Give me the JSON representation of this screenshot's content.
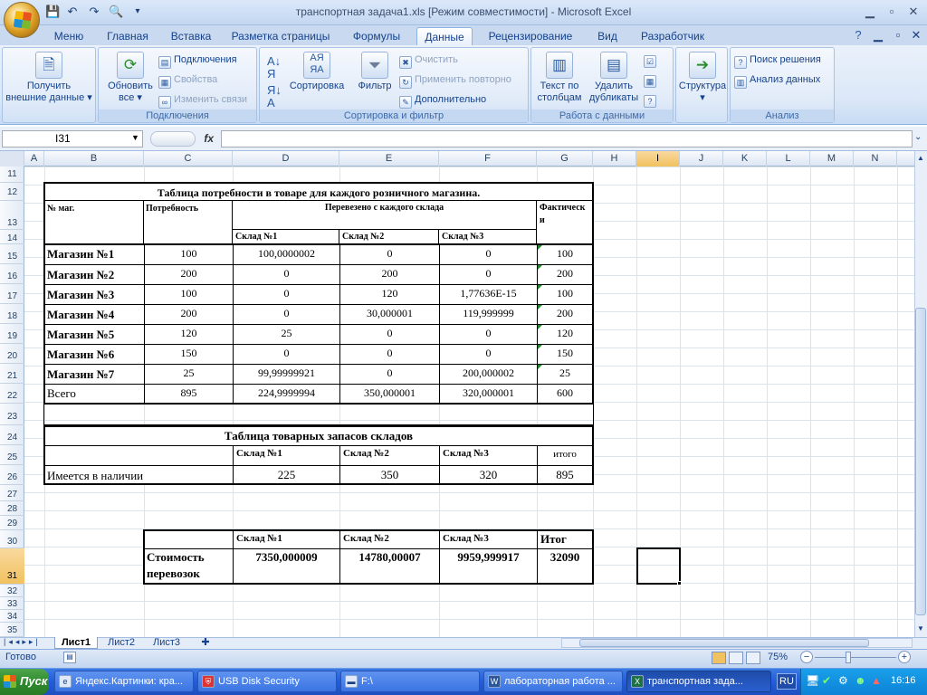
{
  "window": {
    "title": "транспортная задача1.xls  [Режим совместимости] - Microsoft Excel"
  },
  "ribbon_tabs": [
    "Меню",
    "Главная",
    "Вставка",
    "Разметка страницы",
    "Формулы",
    "Данные",
    "Рецензирование",
    "Вид",
    "Разработчик"
  ],
  "ribbon": {
    "get_external": {
      "line1": "Получить",
      "line2": "внешние данные ▾"
    },
    "refresh": {
      "line1": "Обновить",
      "line2": "все ▾"
    },
    "connections": "Подключения",
    "properties": "Свойства",
    "edit_links": "Изменить связи",
    "group_connections": "Подключения",
    "sort": "Сортировка",
    "filter": "Фильтр",
    "clear": "Очистить",
    "reapply": "Применить повторно",
    "advanced": "Дополнительно",
    "group_sort": "Сортировка и фильтр",
    "text_to_cols": {
      "line1": "Текст по",
      "line2": "столбцам"
    },
    "remove_dup": {
      "line1": "Удалить",
      "line2": "дубликаты"
    },
    "group_data": "Работа с данными",
    "outline": {
      "line1": "Структура",
      "line2": "▾"
    },
    "solver": "Поиск решения",
    "data_analysis": "Анализ данных",
    "group_analysis": "Анализ"
  },
  "name_box": "I31",
  "fx": "fx",
  "columns": [
    "A",
    "B",
    "C",
    "D",
    "E",
    "F",
    "G",
    "H",
    "I",
    "J",
    "K",
    "L",
    "M",
    "N"
  ],
  "rows": [
    "11",
    "12",
    "13",
    "14",
    "15",
    "16",
    "17",
    "18",
    "19",
    "20",
    "21",
    "22",
    "23",
    "24",
    "25",
    "26",
    "27",
    "28",
    "29",
    "30",
    "31",
    "32",
    "33",
    "34",
    "35"
  ],
  "table1": {
    "title": "Таблица потребности в товаре для каждого розничного магазина.",
    "h_shop": "№ маг.",
    "h_need": "Потребность",
    "h_shipped": "Перевезено с каждого склада",
    "h_actual": "Фактически",
    "h_w1": "Склад №1",
    "h_w2": "Склад №2",
    "h_w3": "Склад №3",
    "rows": [
      {
        "shop": "Магазин №1",
        "need": "100",
        "w1": "100,0000002",
        "w2": "0",
        "w3": "0",
        "actual": "100"
      },
      {
        "shop": "Магазин №2",
        "need": "200",
        "w1": "0",
        "w2": "200",
        "w3": "0",
        "actual": "200"
      },
      {
        "shop": "Магазин №3",
        "need": "100",
        "w1": "0",
        "w2": "120",
        "w3": "1,77636E-15",
        "actual": "100"
      },
      {
        "shop": "Магазин №4",
        "need": "200",
        "w1": "0",
        "w2": "30,000001",
        "w3": "119,999999",
        "actual": "200"
      },
      {
        "shop": "Магазин №5",
        "need": "120",
        "w1": "25",
        "w2": "0",
        "w3": "0",
        "actual": "120"
      },
      {
        "shop": "Магазин №6",
        "need": "150",
        "w1": "0",
        "w2": "0",
        "w3": "0",
        "actual": "150"
      },
      {
        "shop": "Магазин №7",
        "need": "25",
        "w1": "99,99999921",
        "w2": "0",
        "w3": "200,000002",
        "actual": "25"
      }
    ],
    "total": {
      "label": "Всего",
      "need": "895",
      "w1": "224,9999994",
      "w2": "350,000001",
      "w3": "320,000001",
      "actual": "600"
    }
  },
  "table2": {
    "title": "Таблица товарных запасов складов",
    "h_w1": "Склад №1",
    "h_w2": "Склад №2",
    "h_w3": "Склад №3",
    "h_total": "итого",
    "label": "Имеется в наличии",
    "w1": "225",
    "w2": "350",
    "w3": "320",
    "total": "895"
  },
  "table3": {
    "h_w1": "Склад №1",
    "h_w2": "Склад №2",
    "h_w3": "Склад №3",
    "h_total": "Итог",
    "label1": "Стоимость",
    "label2": "перевозок",
    "w1": "7350,000009",
    "w2": "14780,00007",
    "w3": "9959,999917",
    "total": "32090"
  },
  "sheet_tabs": [
    "Лист1",
    "Лист2",
    "Лист3"
  ],
  "status": {
    "ready": "Готово",
    "zoom": "75%"
  },
  "taskbar": {
    "start": "Пуск",
    "tasks": [
      "Яндекс.Картинки: кра...",
      "USB Disk Security",
      "F:\\",
      "лабораторная работа ...",
      "транспортная зада..."
    ],
    "lang": "RU",
    "clock": "16:16"
  }
}
